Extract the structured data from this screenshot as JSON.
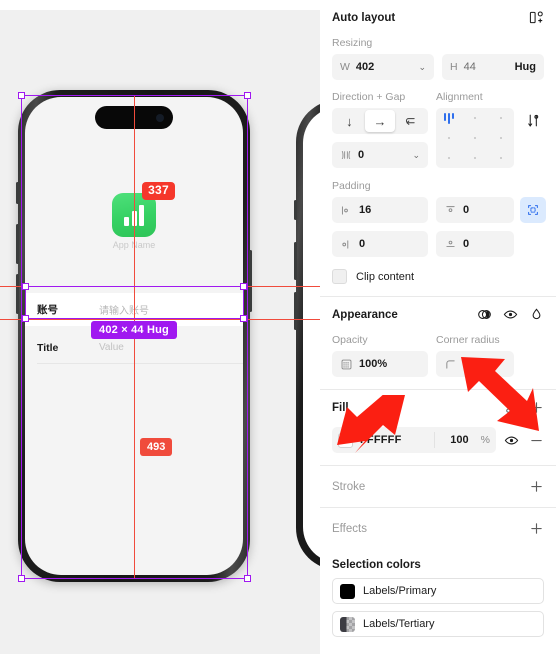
{
  "canvas": {
    "app_icon": {
      "badge": "337",
      "label": "App Name",
      "icon_name": "bar-chart-app-icon",
      "color": "#35d163"
    },
    "form_rows": [
      {
        "label": "账号",
        "value": "请输入账号"
      },
      {
        "label": "Title",
        "value": "Value"
      }
    ],
    "size_badge": "402 × 44 Hug",
    "distance_badge": "493",
    "selection_color": "#a018f0",
    "guide_color": "#f04b3c"
  },
  "panel": {
    "auto_layout": {
      "title": "Auto layout",
      "add_icon": "add-auto-layout-icon",
      "resizing_label": "Resizing",
      "width": {
        "prefix": "W",
        "value": "402"
      },
      "height": {
        "prefix": "H",
        "value": "44",
        "mode": "Hug"
      },
      "direction_label": "Direction + Gap",
      "direction_options": [
        {
          "name": "vertical",
          "glyph": "↓",
          "active": false
        },
        {
          "name": "horizontal",
          "glyph": "→",
          "active": true
        },
        {
          "name": "wrap",
          "glyph": "⮌",
          "active": false
        }
      ],
      "gap": {
        "prefix": "gap",
        "value": "0"
      },
      "alignment_label": "Alignment",
      "alignment_selected": "top-left",
      "advanced_icon": "layout-settings-icon",
      "padding_label": "Padding",
      "padding": {
        "left": "16",
        "top": "0",
        "right": "0",
        "bottom": "0"
      },
      "padding_toggle_icon": "individual-padding-icon",
      "clip_content": "Clip content"
    },
    "appearance": {
      "title": "Appearance",
      "icons": [
        "blend-mode-icon",
        "visibility-eye-icon",
        "color-drop-icon"
      ],
      "opacity_label": "Opacity",
      "opacity_value": "100%",
      "corner_label": "Corner radius",
      "corner_value": "0"
    },
    "fill": {
      "title": "Fill",
      "style_icon": "fill-styles-icon",
      "add_icon": "add-fill-icon",
      "hex": "FFFFFF",
      "opacity": "100",
      "percent": "%",
      "visibility_icon": "visibility-eye-icon",
      "remove_icon": "remove-fill-icon"
    },
    "stroke": {
      "title": "Stroke",
      "add_icon": "add-stroke-icon"
    },
    "effects": {
      "title": "Effects",
      "add_icon": "add-effect-icon"
    },
    "selection_colors": {
      "title": "Selection colors",
      "items": [
        {
          "label": "Labels/Primary",
          "color": "#000000"
        },
        {
          "label": "Labels/Tertiary",
          "color": "#3C3C43"
        }
      ]
    }
  }
}
